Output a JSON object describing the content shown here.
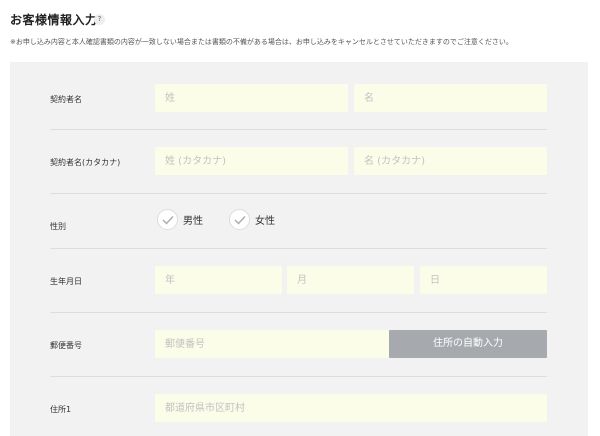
{
  "header": {
    "title": "お客様情報入力",
    "help": "?",
    "notice": "※お申し込み内容と本人確認書類の内容が一致しない場合または書類の不備がある場合は、お申し込みをキャンセルとさせていただきますのでご注意ください。"
  },
  "form": {
    "name": {
      "label": "契約者名",
      "last_placeholder": "姓",
      "first_placeholder": "名"
    },
    "kana": {
      "label": "契約者名(カタカナ)",
      "last_placeholder": "姓 (カタカナ)",
      "first_placeholder": "名 (カタカナ)"
    },
    "gender": {
      "label": "性別",
      "options": [
        "男性",
        "女性"
      ]
    },
    "birthday": {
      "label": "生年月日",
      "year_placeholder": "年",
      "month_placeholder": "月",
      "day_placeholder": "日"
    },
    "postal": {
      "label": "郵便番号",
      "placeholder": "郵便番号",
      "button": "住所の自動入力"
    },
    "address1": {
      "label": "住所1",
      "placeholder": "都道府県市区町村"
    }
  },
  "colors": {
    "field_bg": "#fcfde8",
    "button_bg": "#a6a9ad",
    "panel_bg": "#f2f2f2"
  }
}
